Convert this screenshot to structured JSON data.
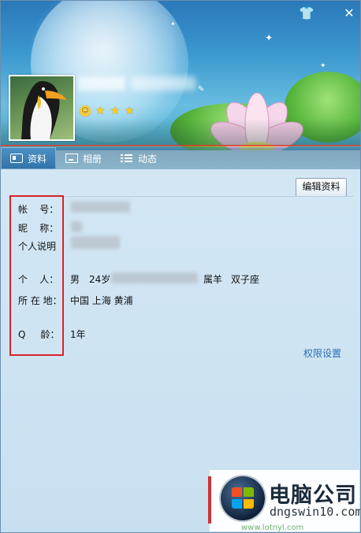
{
  "window": {
    "controls": {
      "skin_glyph": "👕",
      "close_glyph": "✕"
    }
  },
  "profile": {
    "level_icons": [
      "sun-icon",
      "star-icon",
      "star-icon",
      "star-icon"
    ]
  },
  "tabs": [
    {
      "label": "资料",
      "icon": "card-icon",
      "active": true
    },
    {
      "label": "相册",
      "icon": "album-icon",
      "active": false
    },
    {
      "label": "动态",
      "icon": "feed-icon",
      "active": false
    }
  ],
  "toolbar": {
    "edit_label": "编辑资料"
  },
  "info": {
    "account_label": "帐    号：",
    "nickname_label": "昵    称：",
    "signature_label": "个人说明",
    "personal_label": "个    人：",
    "personal_gender": "男",
    "personal_age": "24岁",
    "personal_zodiac": "属羊",
    "personal_sign": "双子座",
    "location_label": "所 在 地：",
    "location_value": "中国 上海 黄浦",
    "qage_label": "Q     龄：",
    "qage_value": "1年"
  },
  "links": {
    "permissions": "权限设置"
  },
  "watermark": {
    "title": "电脑公司",
    "subtitle": "dngswin10.com",
    "bottom": "www.lotnyl.com"
  },
  "colors": {
    "accent": "#2f73a8",
    "highlight_box": "#d8232a",
    "link": "#2a6fba"
  }
}
